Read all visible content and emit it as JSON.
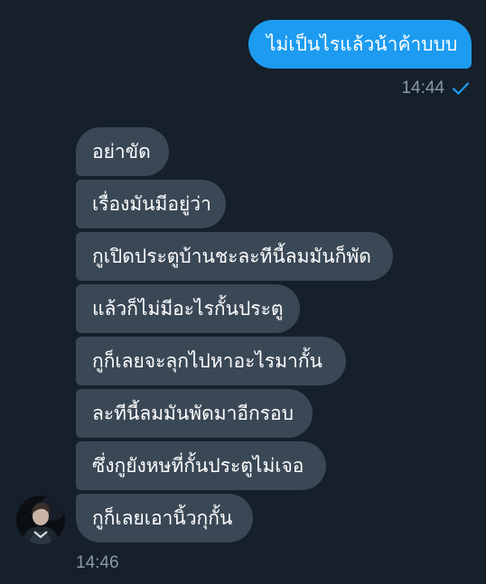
{
  "conversation": {
    "sent": {
      "text": "ไม่เป็นไรแล้วน้าค้าบบบ",
      "time": "14:44",
      "status_icon": "check-icon"
    },
    "received": {
      "messages": [
        {
          "text": "อย่าขัด"
        },
        {
          "text": "เรื่องมันมีอยู่ว่า"
        },
        {
          "text": "กูเปิดประตูบ้านชะละทีนี้ลมมันก็พัด"
        },
        {
          "text": "แล้วก็ไม่มีอะไรกั้นประตู"
        },
        {
          "text": "กูก็เลยจะลุกไปหาอะไรมากั้น"
        },
        {
          "text": "ละทีนี้ลมมันพัดมาอีกรอบ"
        },
        {
          "text": "ซึ่งกูยังหษที่กั้นประตูไม่เจอ"
        },
        {
          "text": "กูก็เลยเอานิ้วกุกั้น"
        }
      ],
      "time": "14:46",
      "avatar_icon": "avatar"
    }
  },
  "colors": {
    "background": "#15202b",
    "sent_bubble": "#1d9bf0",
    "received_bubble": "#3a4856",
    "timestamp": "#8b98a5",
    "read_check": "#1d9bf0"
  }
}
